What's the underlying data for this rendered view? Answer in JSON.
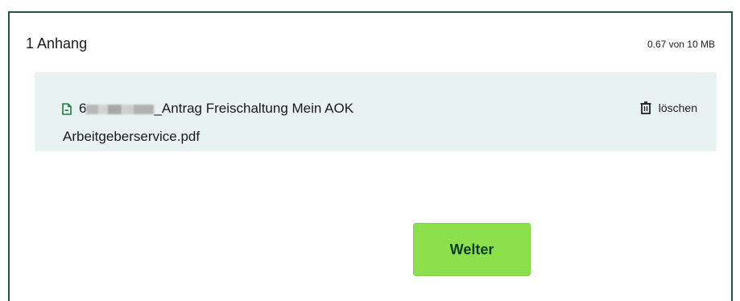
{
  "attachments": {
    "title": "1 Anhang",
    "size_info": "0.67 von 10 MB",
    "file": {
      "name_start": "6",
      "name_rest": "_Antrag Freischaltung Mein AOK",
      "name_line2": "Arbeitgeberservice.pdf",
      "icon": "pdf-file-icon"
    },
    "delete_label": "löschen",
    "delete_icon": "trash-icon"
  },
  "actions": {
    "continue_label": "Welter"
  },
  "colors": {
    "border": "#1d5a3a",
    "attachment_bg": "#e8f3f1",
    "button_bg": "#8be04b",
    "button_text": "#0d3b29",
    "icon_green": "#1f7a4c"
  }
}
